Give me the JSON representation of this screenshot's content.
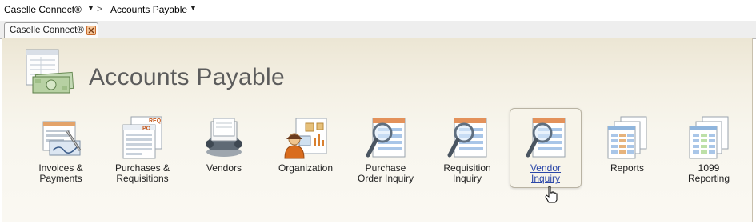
{
  "breadcrumb": {
    "root": "Caselle Connect®",
    "separator": ">",
    "current": "Accounts Payable"
  },
  "tabs": [
    {
      "label": "Caselle Connect®",
      "close_icon": "close-icon"
    }
  ],
  "header": {
    "title": "Accounts Payable",
    "icon": "accounts-payable-money-icon"
  },
  "modules": [
    {
      "label_line1": "Invoices &",
      "label_line2": "Payments",
      "icon": "invoice-icon"
    },
    {
      "label_line1": "Purchases &",
      "label_line2": "Requisitions",
      "icon": "purchase-order-icon"
    },
    {
      "label_line1": "Vendors",
      "label_line2": "",
      "icon": "rolodex-icon"
    },
    {
      "label_line1": "Organization",
      "label_line2": "",
      "icon": "organization-icon"
    },
    {
      "label_line1": "Purchase",
      "label_line2": "Order Inquiry",
      "icon": "magnifier-document-icon"
    },
    {
      "label_line1": "Requisition",
      "label_line2": "Inquiry",
      "icon": "magnifier-document-icon"
    },
    {
      "label_line1": "Vendor",
      "label_line2": "Inquiry",
      "icon": "magnifier-document-icon",
      "hovered": true
    },
    {
      "label_line1": "Reports",
      "label_line2": "",
      "icon": "reports-icon"
    },
    {
      "label_line1": "1099",
      "label_line2": "Reporting",
      "icon": "reporting-1099-icon"
    }
  ],
  "colors": {
    "panel_background": "#f4f0e4",
    "title_text": "#5c5c5c",
    "link_hover": "#2a46a8",
    "tab_close": "#f6c79b"
  }
}
